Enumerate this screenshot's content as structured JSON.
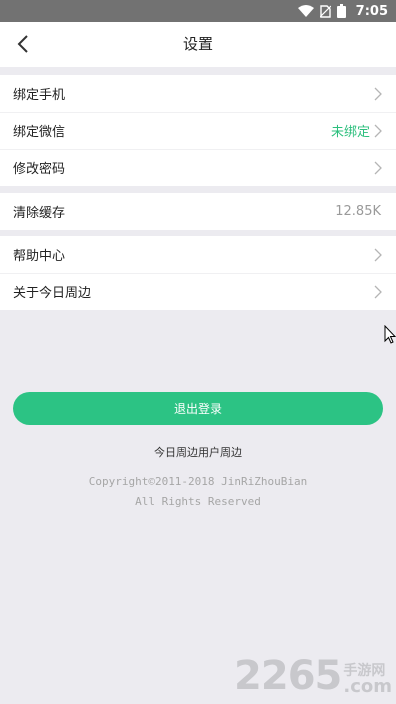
{
  "status_bar": {
    "time": "7:05"
  },
  "nav": {
    "title": "设置"
  },
  "groups": [
    {
      "items": [
        {
          "label": "绑定手机",
          "value": ""
        },
        {
          "label": "绑定微信",
          "value": "未绑定"
        },
        {
          "label": "修改密码",
          "value": ""
        }
      ]
    },
    {
      "items": [
        {
          "label": "清除缓存",
          "value": "12.85K"
        }
      ]
    },
    {
      "items": [
        {
          "label": "帮助中心",
          "value": ""
        },
        {
          "label": "关于今日周边",
          "value": ""
        }
      ]
    }
  ],
  "logout_label": "退出登录",
  "footer": {
    "user_name": "今日周边用户周边",
    "copyright_line1": "Copyright©2011-2018 JinRiZhouBian",
    "copyright_line2": "All Rights Reserved"
  },
  "watermark": {
    "number": "2265",
    "cn": "手游网",
    "domain": ".com"
  },
  "colors": {
    "accent": "#2cc384",
    "status_bar": "#727272",
    "background": "#ecebf0"
  }
}
